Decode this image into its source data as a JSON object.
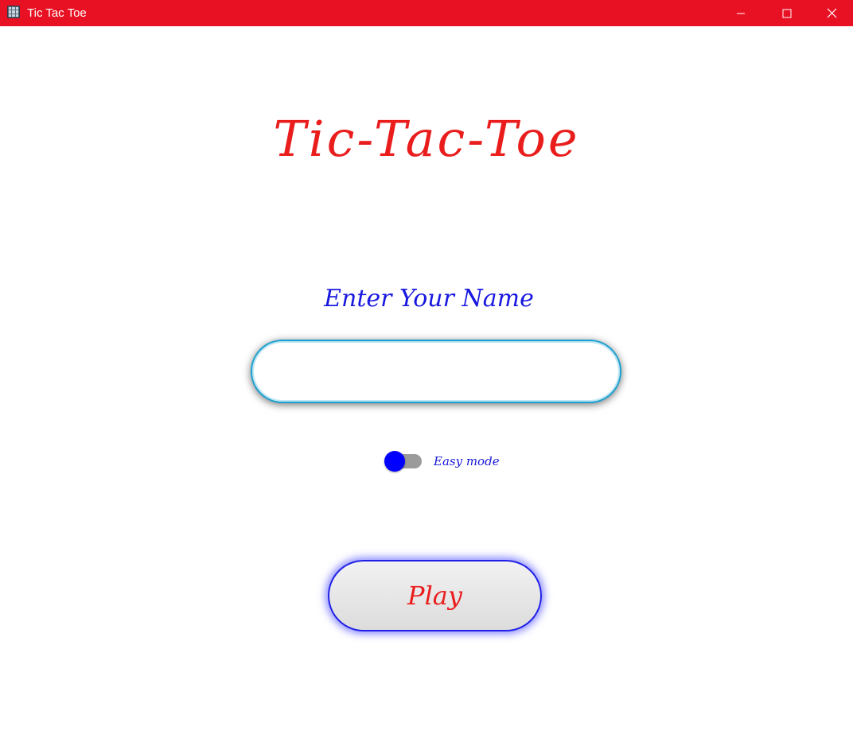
{
  "window": {
    "title": "Tic Tac Toe",
    "minimize_icon": "minimize-icon",
    "maximize_icon": "maximize-icon",
    "close_icon": "close-icon",
    "titlebar_color": "#e81123"
  },
  "main": {
    "heading": "Tic-Tac-Toe",
    "name_label": "Enter Your Name",
    "name_input": {
      "value": "",
      "placeholder": ""
    },
    "mode_toggle": {
      "label": "Easy mode",
      "checked": false,
      "knob_color": "#0000ff"
    },
    "play_label": "Play"
  },
  "colors": {
    "heading": "#ea1d1d",
    "label": "#1818e0",
    "input_border": "#1aa0d0",
    "play_border": "#2020e8"
  }
}
